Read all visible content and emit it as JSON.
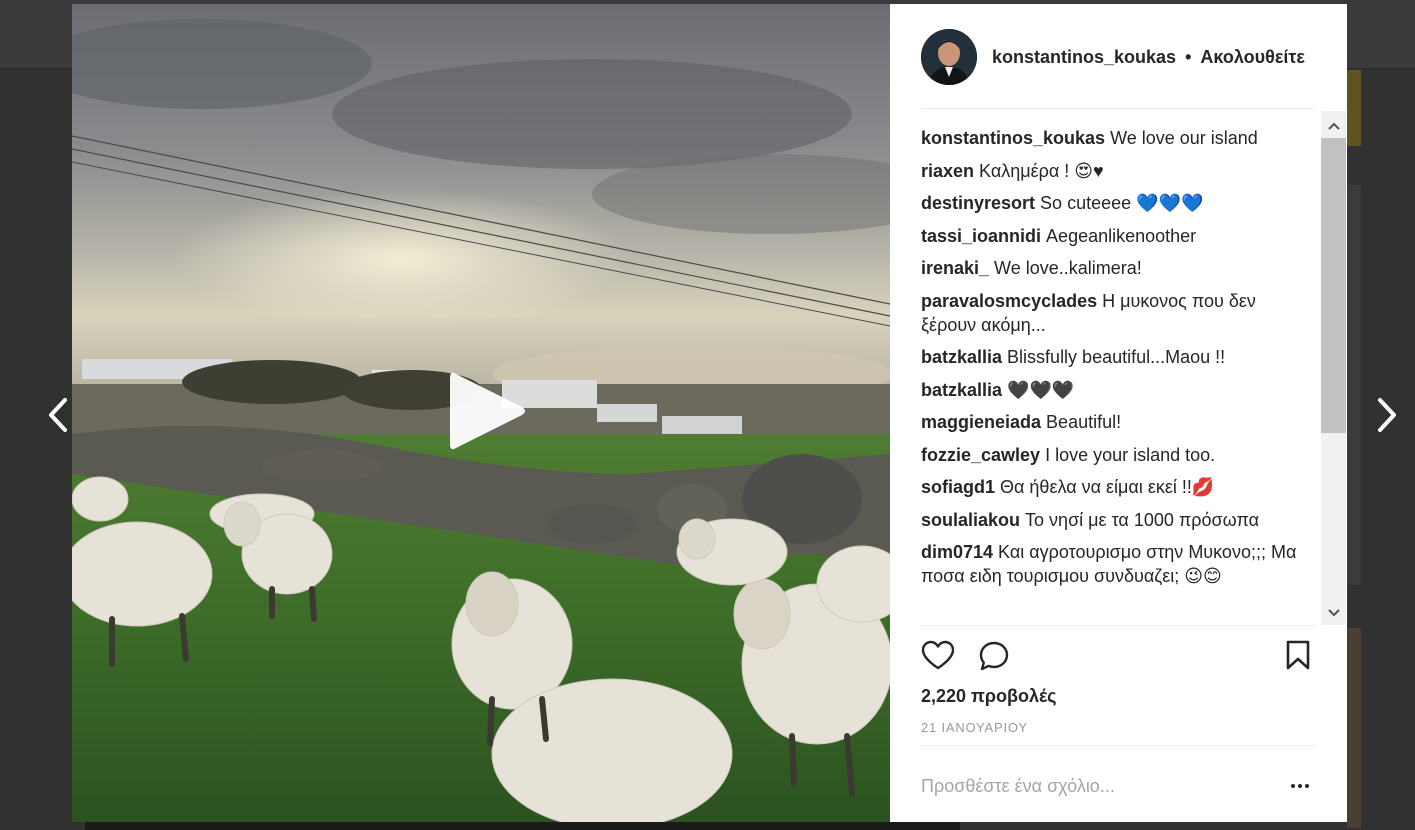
{
  "post": {
    "username": "konstantinos_koukas",
    "separator": "•",
    "follow_status": "Ακολουθείτε",
    "views": "2,220 προβολές",
    "date": "21 ΙΑΝΟΥΑΡΙΟΥ",
    "comment_placeholder": "Προσθέστε ένα σχόλιο..."
  },
  "comments": [
    {
      "user": "konstantinos_koukas",
      "text": "We love our island"
    },
    {
      "user": "riaxen",
      "text": "Καλημέρα ! 😍♥"
    },
    {
      "user": "destinyresort",
      "text": "So cuteeee 💙💙💙"
    },
    {
      "user": "tassi_ioannidi",
      "text": "Aegeanlikenoother"
    },
    {
      "user": "irenaki_",
      "text": "We love..kalimera!"
    },
    {
      "user": "paravalosmcyclades",
      "text": "Η μυκονος που δεν ξέρουν ακόμη..."
    },
    {
      "user": "batzkallia",
      "text": "Blissfully beautiful...Maou !!"
    },
    {
      "user": "batzkallia",
      "text": "🖤🖤🖤"
    },
    {
      "user": "maggieneiada",
      "text": "Beautiful!"
    },
    {
      "user": "fozzie_cawley",
      "text": "I love your island too."
    },
    {
      "user": "sofiagd1",
      "text": "Θα ήθελα να είμαι εκεί !!💋"
    },
    {
      "user": "soulaliakou",
      "text": "Το νησί με τα 1000 πρόσωπα"
    },
    {
      "user": "dim0714",
      "text": "Και αγροτουρισμο στην Μυκονο;;; Μα ποσα ειδη τουρισμου συνδυαζει; 😉😊"
    }
  ],
  "icons": {
    "prev": "chevron-left-icon",
    "next": "chevron-right-icon",
    "play": "play-icon",
    "like": "heart-icon",
    "comment": "speech-bubble-icon",
    "save": "bookmark-icon",
    "more": "ellipsis-icon"
  }
}
